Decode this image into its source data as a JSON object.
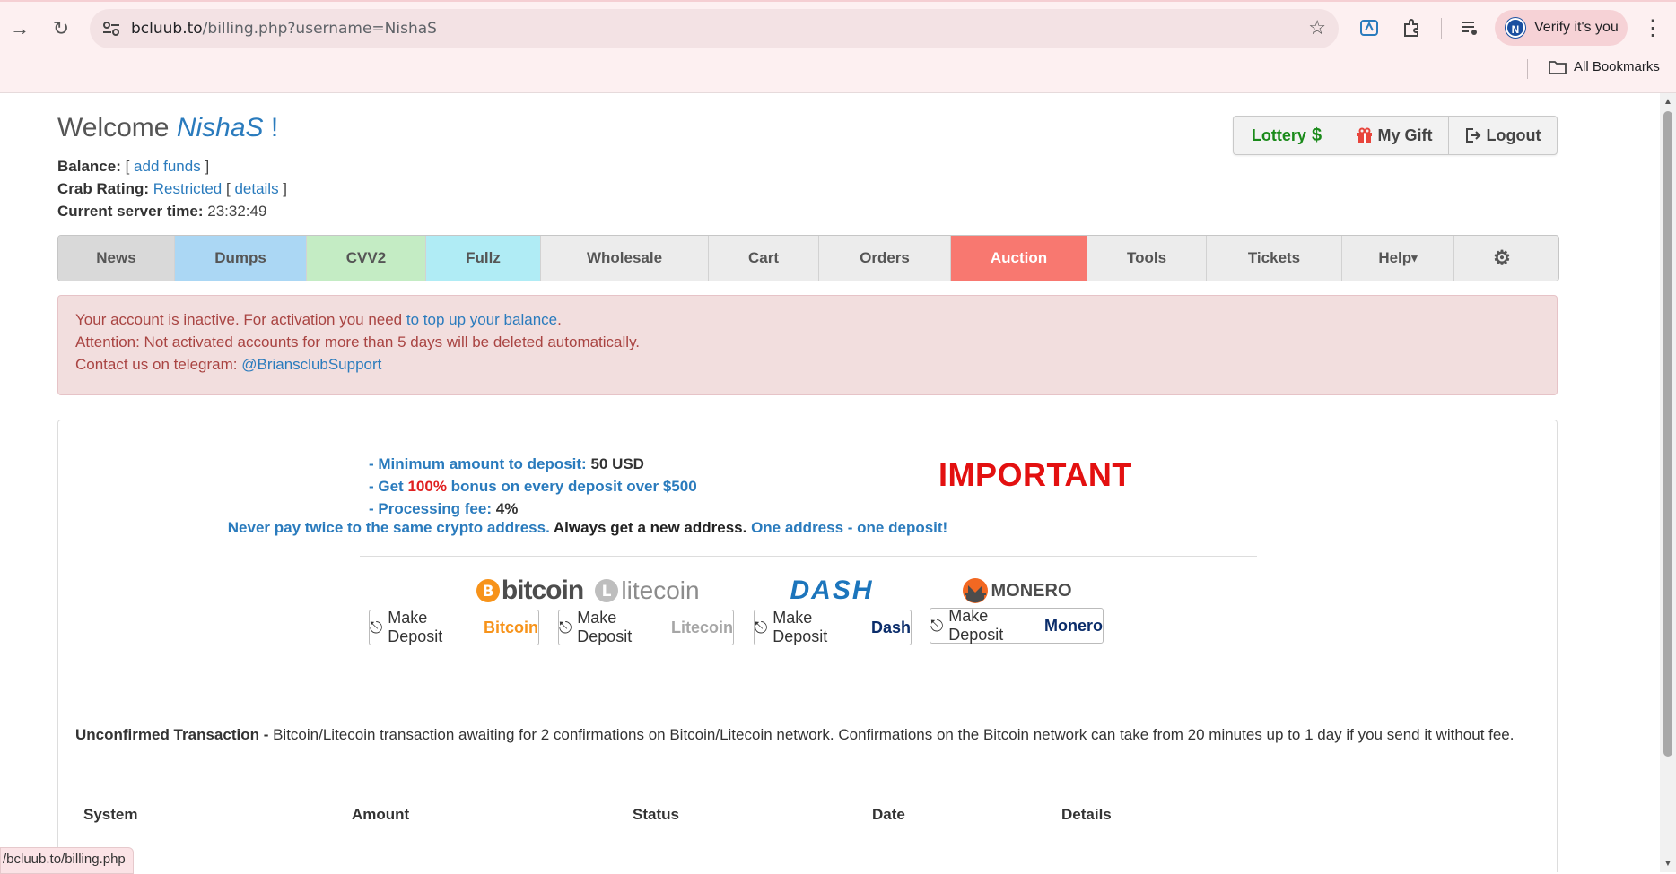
{
  "browser": {
    "url_domain": "bcluub.to",
    "url_path": "/billing.php?username=NishaS",
    "verify_label": "Verify it's you",
    "avatar_letter": "N",
    "all_bookmarks": "All Bookmarks",
    "status_url": "/bcluub.to/billing.php"
  },
  "header": {
    "welcome": "Welcome",
    "username": "NishaS",
    "bang": "!",
    "balance_label": "Balance:",
    "add_funds": "add funds",
    "crab_label": "Crab Rating:",
    "crab_value": "Restricted",
    "details_link": "details",
    "time_label": "Current server time:",
    "time_value": "23:32:49"
  },
  "topbuttons": {
    "lottery": "Lottery",
    "lottery_sign": "$",
    "mygift": "My Gift",
    "logout": "Logout"
  },
  "nav": [
    {
      "label": "News",
      "bg": "#d9d9d9",
      "color": "#555555",
      "w": 130
    },
    {
      "label": "Dumps",
      "bg": "#abd7f4",
      "color": "#555555",
      "w": 147
    },
    {
      "label": "CVV2",
      "bg": "#c4ecc4",
      "color": "#555555",
      "w": 133
    },
    {
      "label": "Fullz",
      "bg": "#b0ecf5",
      "color": "#555555",
      "w": 128
    },
    {
      "label": "Wholesale",
      "bg": "#ececec",
      "color": "#555555",
      "w": 187
    },
    {
      "label": "Cart",
      "bg": "#ececec",
      "color": "#555555",
      "w": 123
    },
    {
      "label": "Orders",
      "bg": "#ececec",
      "color": "#555555",
      "w": 147
    },
    {
      "label": "Auction",
      "bg": "#f87870",
      "color": "#ffffff",
      "w": 152
    },
    {
      "label": "Tools",
      "bg": "#ececec",
      "color": "#555555",
      "w": 133
    },
    {
      "label": "Tickets",
      "bg": "#ececec",
      "color": "#555555",
      "w": 151
    },
    {
      "label": "Help",
      "bg": "#ececec",
      "color": "#555555",
      "w": 125
    },
    {
      "label": "",
      "bg": "#ececec",
      "color": "#555555",
      "w": 106
    }
  ],
  "alert": {
    "line1_pre": "Your account is inactive. For activation you need ",
    "line1_link": "to top up your balance",
    "line1_post": ".",
    "line2": "Attention: Not activated accounts for more than 5 days will be deleted automatically.",
    "line3_pre": "Contact us on telegram: ",
    "line3_link": "@BriansclubSupport"
  },
  "deposit": {
    "min_label": "- Minimum amount to deposit:",
    "min_value": "50 USD",
    "bonus_pre": "- Get ",
    "bonus_pct": "100%",
    "bonus_post": " bonus on every deposit over $500",
    "fee_label": "- Processing fee:",
    "fee_value": "4%",
    "important": "IMPORTANT",
    "never_a": "Never pay twice to the same crypto address.",
    "never_b": "Always get a new address.",
    "never_c": "One address - one deposit!",
    "make_deposit": "Make Deposit",
    "coins": {
      "bitcoin": "Bitcoin",
      "litecoin": "Litecoin",
      "dash": "Dash",
      "monero": "Monero"
    },
    "logos": {
      "bitcoin": "bitcoin",
      "litecoin": "litecoin",
      "dash": "DASH",
      "monero": "MONERO"
    }
  },
  "unconfirmed": {
    "label": "Unconfirmed Transaction -",
    "text": " Bitcoin/Litecoin transaction awaiting for 2 confirmations on Bitcoin/Litecoin network. Confirmations on the Bitcoin network can take from 20 minutes up to 1 day if you send it without fee."
  },
  "table": {
    "headers": [
      "System",
      "Amount",
      "Status",
      "Date",
      "Details"
    ]
  }
}
